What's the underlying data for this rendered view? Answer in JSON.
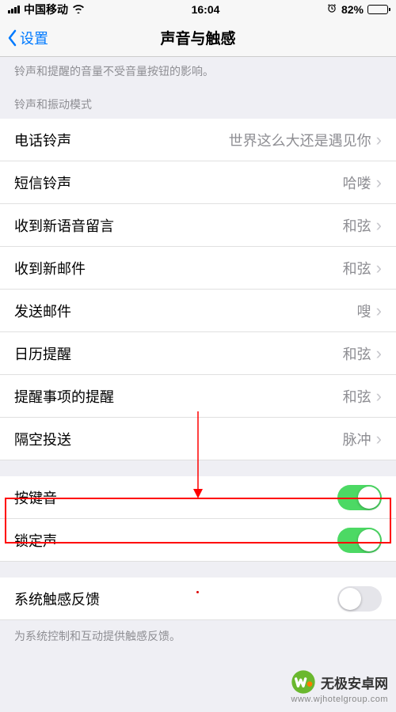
{
  "status": {
    "carrier": "中国移动",
    "time": "16:04",
    "battery": "82%"
  },
  "nav": {
    "back": "设置",
    "title": "声音与触感"
  },
  "hint_top": "铃声和提醒的音量不受音量按钮的影响。",
  "section1_header": "铃声和振动模式",
  "rows": [
    {
      "label": "电话铃声",
      "value": "世界这么大还是遇见你"
    },
    {
      "label": "短信铃声",
      "value": "哈喽"
    },
    {
      "label": "收到新语音留言",
      "value": "和弦"
    },
    {
      "label": "收到新邮件",
      "value": "和弦"
    },
    {
      "label": "发送邮件",
      "value": "嗖"
    },
    {
      "label": "日历提醒",
      "value": "和弦"
    },
    {
      "label": "提醒事项的提醒",
      "value": "和弦"
    },
    {
      "label": "隔空投送",
      "value": "脉冲"
    }
  ],
  "toggles": {
    "keyboard": "按键音",
    "lock": "锁定声",
    "haptic": "系统触感反馈"
  },
  "footer_hint": "为系统控制和互动提供触感反馈。",
  "watermark": {
    "name": "无极安卓网",
    "url": "www.wjhotelgroup.com"
  }
}
